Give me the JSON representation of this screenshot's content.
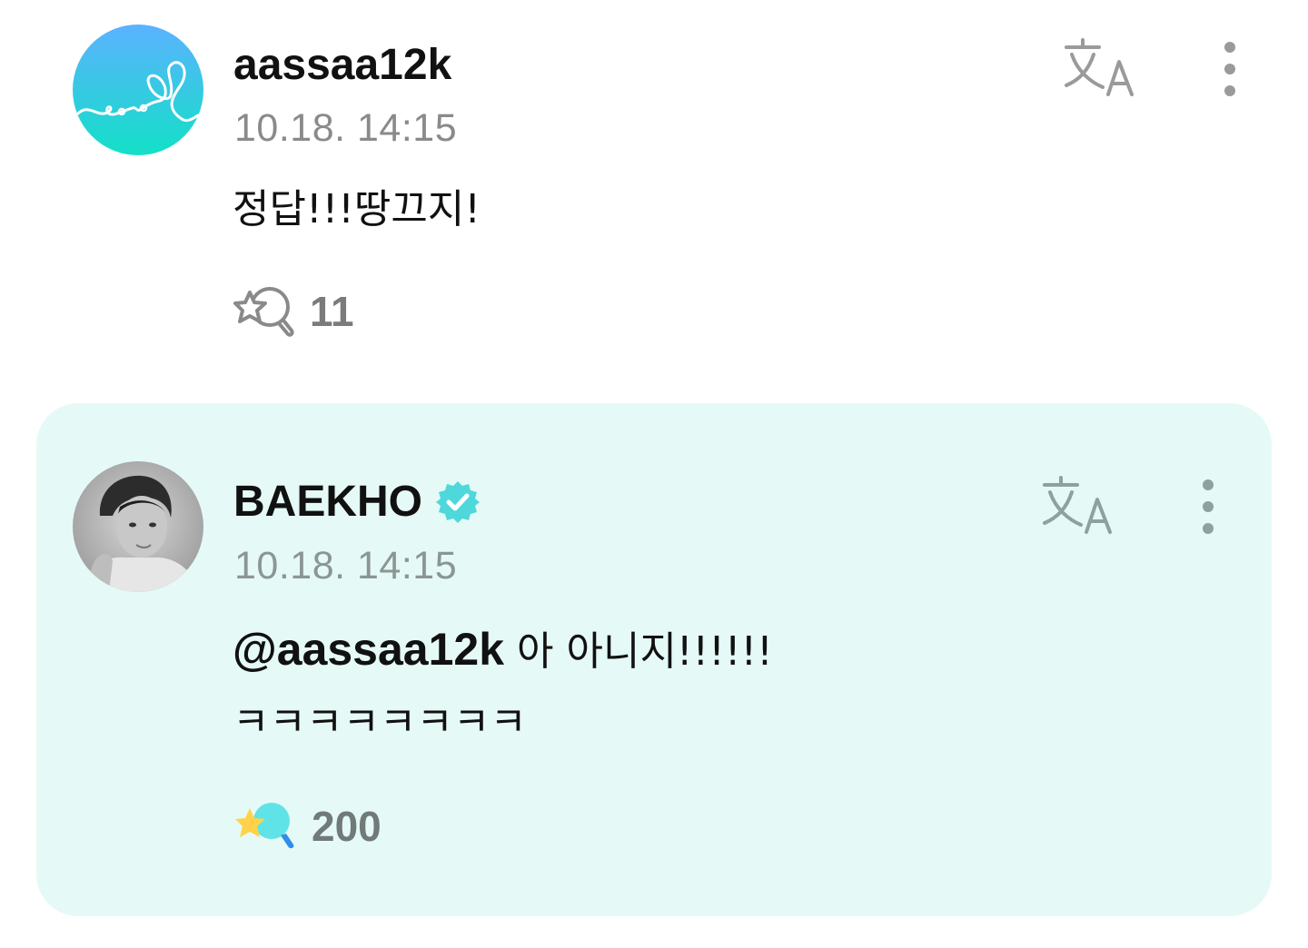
{
  "comments": [
    {
      "author": "aassaa12k",
      "time": "10.18. 14:15",
      "text": "정답!!!땅끄지!",
      "reaction_count": "11",
      "avatar_icon": "heart-scribble-avatar",
      "translate_icon": "translate-icon",
      "more_icon": "more-vertical-icon",
      "reaction_icon": "lightstick-outline-icon",
      "highlighted": false
    },
    {
      "author": "BAEKHO",
      "verified": true,
      "time": "10.18. 14:15",
      "mention": "@aassaa12k",
      "text_line1": " 아 아니지!!!!!!",
      "text_line2": "ㅋㅋㅋㅋㅋㅋㅋㅋ",
      "reaction_count": "200",
      "avatar_icon": "artist-photo-avatar",
      "translate_icon": "translate-icon",
      "more_icon": "more-vertical-icon",
      "reaction_icon": "lightstick-filled-icon",
      "highlighted": true
    }
  ],
  "colors": {
    "highlight_bg": "#e5faf6",
    "verified_badge": "#4fd8dc",
    "avatar_gradient_top": "#5bb2ff",
    "avatar_gradient_bottom": "#13e0c7",
    "meta_gray": "#8a8a8a"
  }
}
